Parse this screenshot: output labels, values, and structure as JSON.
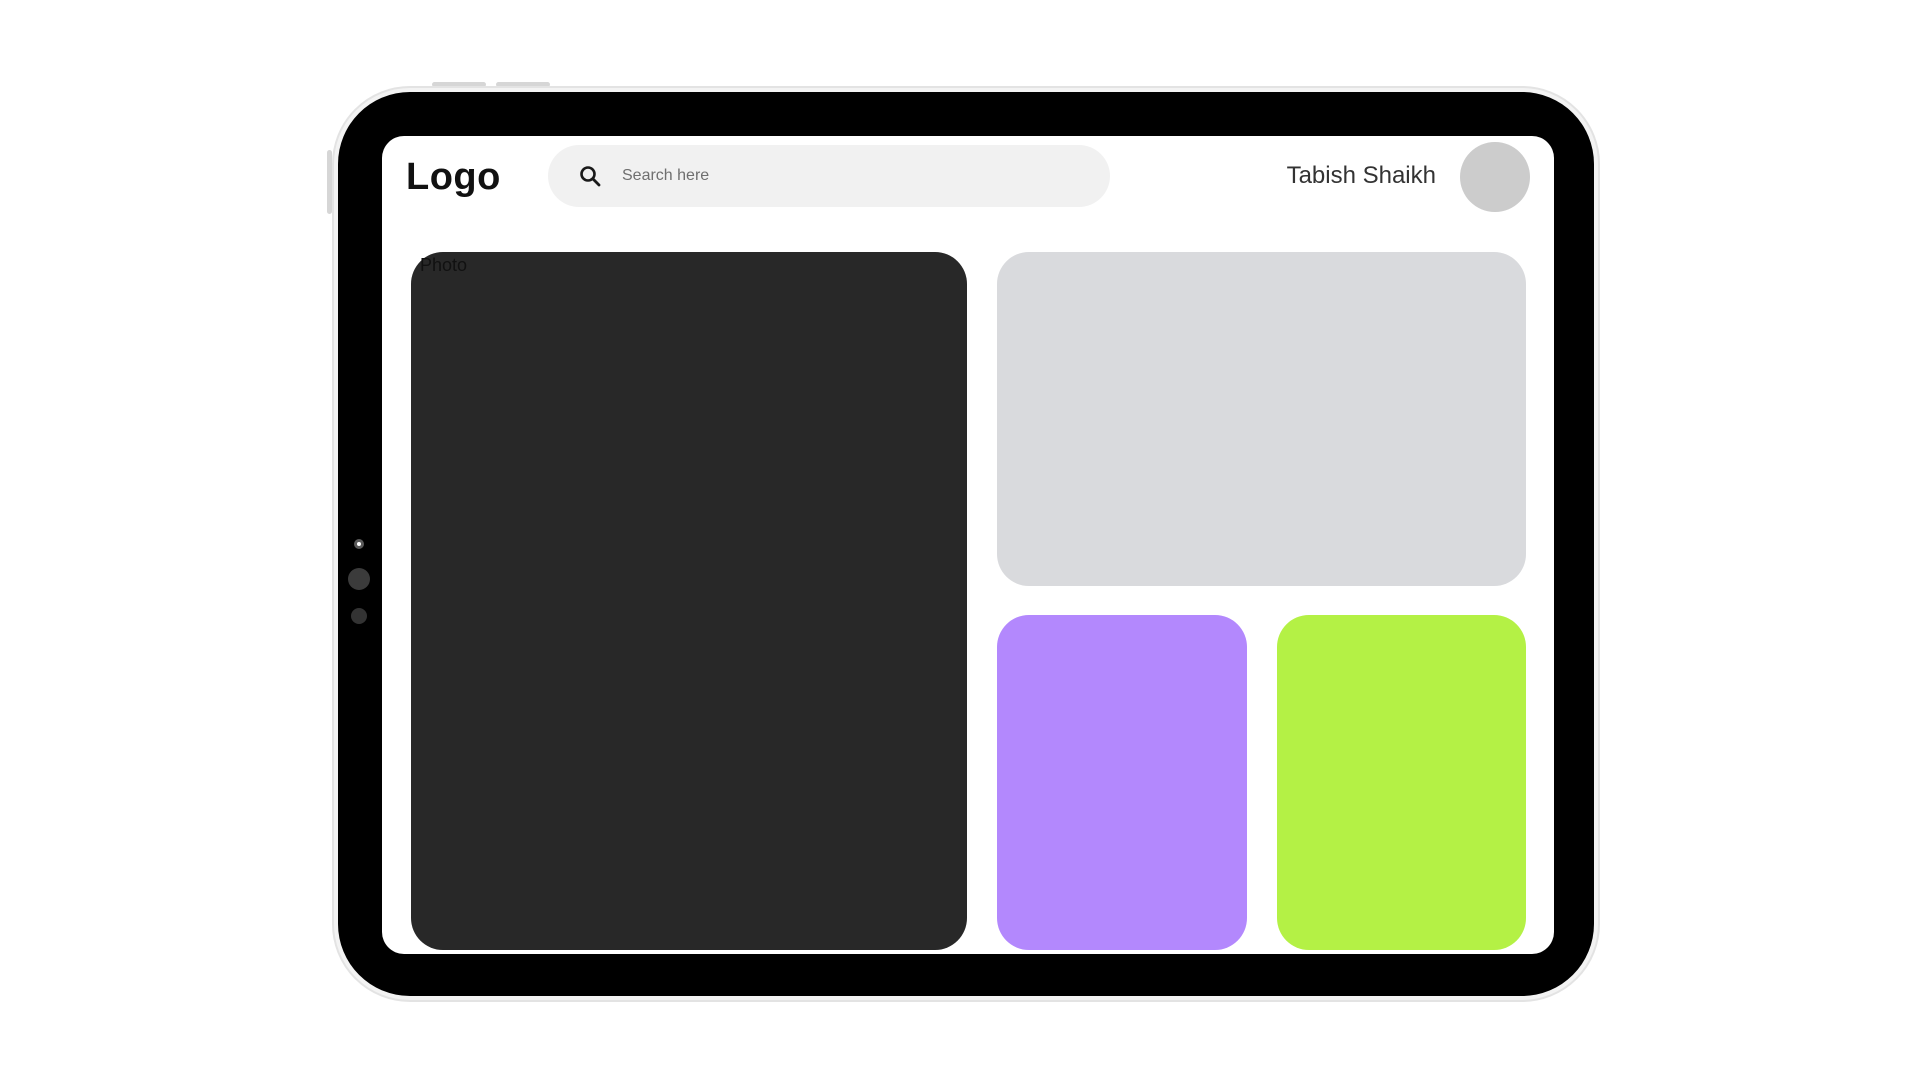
{
  "header": {
    "logo_text": "Logo",
    "search": {
      "placeholder": "Search here",
      "value": "",
      "icon": "search-icon"
    },
    "user": {
      "name": "Tabish Shaikh",
      "avatar_color": "#cccccc"
    }
  },
  "cards": {
    "photo": {
      "label": "Photo",
      "color": "#282828"
    },
    "top_right": {
      "color": "#d9dadd"
    },
    "purple": {
      "color": "#b388fd"
    },
    "green": {
      "color": "#b4f145"
    }
  },
  "device": {
    "bezel_color": "#000000",
    "frame_color": "#f3f3f3"
  }
}
